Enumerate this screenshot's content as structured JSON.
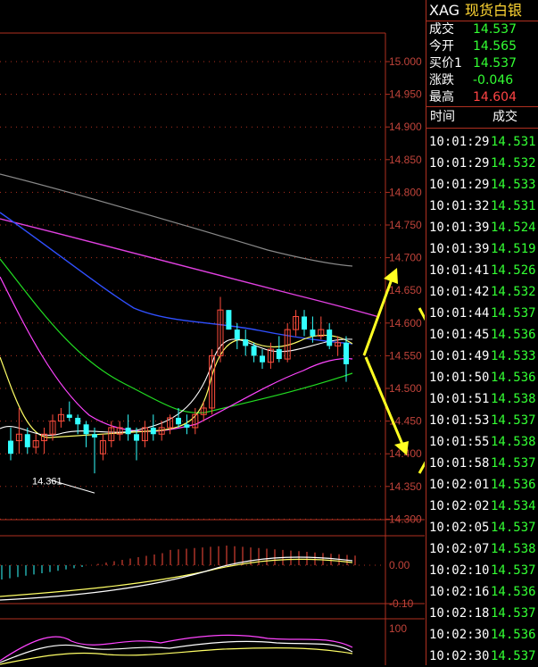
{
  "instrument": {
    "code": "XAG",
    "name": "现货白银"
  },
  "quote": [
    {
      "label": "成交",
      "value": "14.537",
      "color": "#33ff33"
    },
    {
      "label": "今开",
      "value": "14.565",
      "color": "#33ff33"
    },
    {
      "label": "买价1",
      "value": "14.537",
      "color": "#33ff33"
    },
    {
      "label": "涨跌",
      "value": "-0.046",
      "color": "#33ff33"
    },
    {
      "label": "最高",
      "value": "14.604",
      "color": "#ff4444"
    }
  ],
  "ticks_header": {
    "time": "时间",
    "price": "成交"
  },
  "ticks": [
    {
      "time": "10:01:29",
      "price": "14.531"
    },
    {
      "time": "10:01:29",
      "price": "14.532"
    },
    {
      "time": "10:01:29",
      "price": "14.533"
    },
    {
      "time": "10:01:32",
      "price": "14.531"
    },
    {
      "time": "10:01:39",
      "price": "14.524"
    },
    {
      "time": "10:01:39",
      "price": "14.519"
    },
    {
      "time": "10:01:41",
      "price": "14.526"
    },
    {
      "time": "10:01:42",
      "price": "14.532"
    },
    {
      "time": "10:01:44",
      "price": "14.537"
    },
    {
      "time": "10:01:45",
      "price": "14.536"
    },
    {
      "time": "10:01:49",
      "price": "14.533"
    },
    {
      "time": "10:01:50",
      "price": "14.536"
    },
    {
      "time": "10:01:51",
      "price": "14.538"
    },
    {
      "time": "10:01:53",
      "price": "14.537"
    },
    {
      "time": "10:01:55",
      "price": "14.538"
    },
    {
      "time": "10:01:58",
      "price": "14.537"
    },
    {
      "time": "10:02:01",
      "price": "14.536"
    },
    {
      "time": "10:02:02",
      "price": "14.534"
    },
    {
      "time": "10:02:05",
      "price": "14.537"
    },
    {
      "time": "10:02:07",
      "price": "14.538"
    },
    {
      "time": "10:02:10",
      "price": "14.537"
    },
    {
      "time": "10:02:16",
      "price": "14.536"
    },
    {
      "time": "10:02:18",
      "price": "14.537"
    },
    {
      "time": "10:02:30",
      "price": "14.536"
    },
    {
      "time": "10:02:30",
      "price": "14.537"
    }
  ],
  "tick_color": "#33ff33",
  "chart_data": {
    "type": "candlestick",
    "price_axis": {
      "ticks": [
        "15.000",
        "14.950",
        "14.900",
        "14.850",
        "14.800",
        "14.750",
        "14.700",
        "14.650",
        "14.600",
        "14.550",
        "14.500",
        "14.450",
        "14.400",
        "14.350",
        "14.300"
      ],
      "ylim": [
        14.3,
        15.0
      ]
    },
    "low_annotation": "14.361",
    "candles": [
      {
        "o": 14.42,
        "h": 14.44,
        "l": 14.39,
        "c": 14.4
      },
      {
        "o": 14.42,
        "h": 14.47,
        "l": 14.4,
        "c": 14.43
      },
      {
        "o": 14.43,
        "h": 14.44,
        "l": 14.4,
        "c": 14.41
      },
      {
        "o": 14.41,
        "h": 14.43,
        "l": 14.4,
        "c": 14.42
      },
      {
        "o": 14.42,
        "h": 14.44,
        "l": 14.4,
        "c": 14.43
      },
      {
        "o": 14.43,
        "h": 14.46,
        "l": 14.42,
        "c": 14.45
      },
      {
        "o": 14.45,
        "h": 14.47,
        "l": 14.44,
        "c": 14.46
      },
      {
        "o": 14.46,
        "h": 14.48,
        "l": 14.45,
        "c": 14.455
      },
      {
        "o": 14.455,
        "h": 14.46,
        "l": 14.43,
        "c": 14.445
      },
      {
        "o": 14.445,
        "h": 14.45,
        "l": 14.41,
        "c": 14.43
      },
      {
        "o": 14.43,
        "h": 14.44,
        "l": 14.37,
        "c": 14.425
      },
      {
        "o": 14.4,
        "h": 14.43,
        "l": 14.39,
        "c": 14.42
      },
      {
        "o": 14.42,
        "h": 14.45,
        "l": 14.41,
        "c": 14.44
      },
      {
        "o": 14.43,
        "h": 14.45,
        "l": 14.42,
        "c": 14.44
      },
      {
        "o": 14.44,
        "h": 14.46,
        "l": 14.42,
        "c": 14.43
      },
      {
        "o": 14.43,
        "h": 14.44,
        "l": 14.39,
        "c": 14.42
      },
      {
        "o": 14.42,
        "h": 14.45,
        "l": 14.41,
        "c": 14.44
      },
      {
        "o": 14.44,
        "h": 14.46,
        "l": 14.42,
        "c": 14.43
      },
      {
        "o": 14.43,
        "h": 14.45,
        "l": 14.42,
        "c": 14.44
      },
      {
        "o": 14.44,
        "h": 14.46,
        "l": 14.43,
        "c": 14.455
      },
      {
        "o": 14.455,
        "h": 14.47,
        "l": 14.44,
        "c": 14.445
      },
      {
        "o": 14.445,
        "h": 14.46,
        "l": 14.43,
        "c": 14.44
      },
      {
        "o": 14.44,
        "h": 14.47,
        "l": 14.43,
        "c": 14.46
      },
      {
        "o": 14.46,
        "h": 14.48,
        "l": 14.45,
        "c": 14.47
      },
      {
        "o": 14.47,
        "h": 14.56,
        "l": 14.46,
        "c": 14.55
      },
      {
        "o": 14.55,
        "h": 14.64,
        "l": 14.54,
        "c": 14.62
      },
      {
        "o": 14.62,
        "h": 14.62,
        "l": 14.59,
        "c": 14.59
      },
      {
        "o": 14.59,
        "h": 14.6,
        "l": 14.56,
        "c": 14.575
      },
      {
        "o": 14.575,
        "h": 14.59,
        "l": 14.55,
        "c": 14.565
      },
      {
        "o": 14.565,
        "h": 14.57,
        "l": 14.54,
        "c": 14.55
      },
      {
        "o": 14.55,
        "h": 14.56,
        "l": 14.53,
        "c": 14.54
      },
      {
        "o": 14.54,
        "h": 14.57,
        "l": 14.53,
        "c": 14.56
      },
      {
        "o": 14.56,
        "h": 14.58,
        "l": 14.54,
        "c": 14.545
      },
      {
        "o": 14.545,
        "h": 14.6,
        "l": 14.54,
        "c": 14.59
      },
      {
        "o": 14.59,
        "h": 14.62,
        "l": 14.58,
        "c": 14.61
      },
      {
        "o": 14.61,
        "h": 14.62,
        "l": 14.58,
        "c": 14.59
      },
      {
        "o": 14.59,
        "h": 14.61,
        "l": 14.57,
        "c": 14.58
      },
      {
        "o": 14.58,
        "h": 14.61,
        "l": 14.575,
        "c": 14.59
      },
      {
        "o": 14.59,
        "h": 14.6,
        "l": 14.56,
        "c": 14.565
      },
      {
        "o": 14.565,
        "h": 14.58,
        "l": 14.55,
        "c": 14.57
      },
      {
        "o": 14.57,
        "h": 14.58,
        "l": 14.51,
        "c": 14.537
      }
    ],
    "macd_axis": {
      "ticks": [
        "0.00",
        "-0.10"
      ]
    },
    "rsi_axis": {
      "ticks": [
        "100"
      ]
    }
  },
  "colors": {
    "up": "#ff4d3d",
    "down": "#33ffff",
    "grid": "#b03020",
    "axis_text": "#c0433a",
    "arrow": "#ffff22"
  }
}
